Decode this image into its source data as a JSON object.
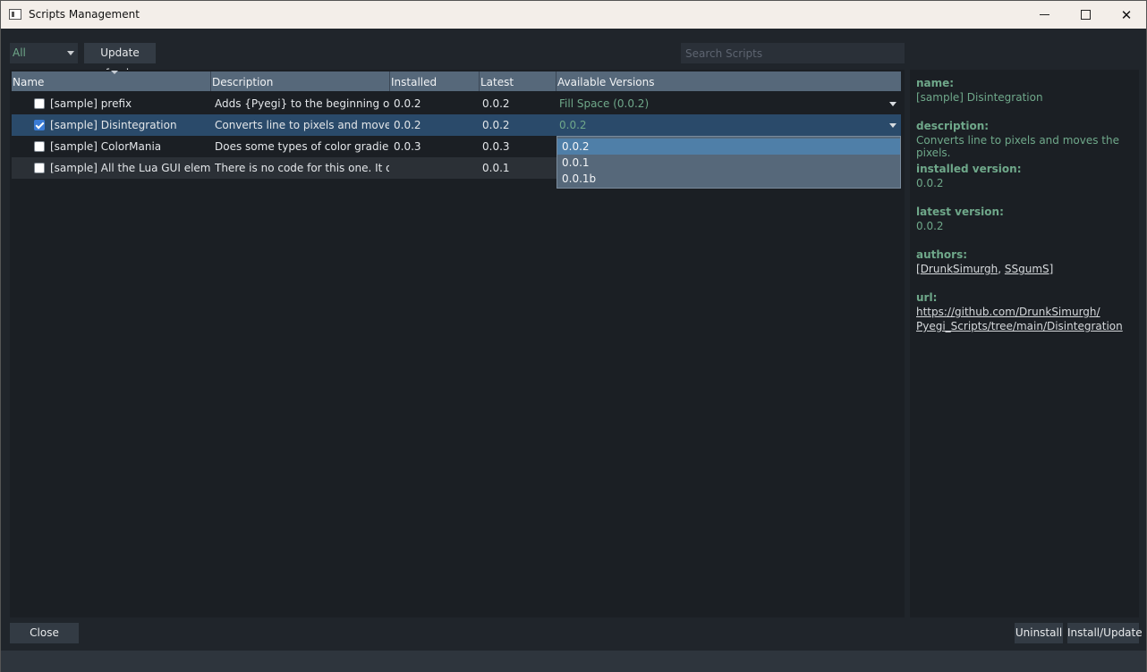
{
  "window": {
    "title": "Scripts Management"
  },
  "toolbar": {
    "filter_value": "All",
    "update_feeds_label": "Update feeds",
    "search_placeholder": "Search Scripts"
  },
  "table": {
    "columns": [
      "Name",
      "Description",
      "Installed Version",
      "Latest Version",
      "Available Versions"
    ],
    "rows": [
      {
        "checked": false,
        "name": "[sample] prefix",
        "description": "Adds {Pyegi} to the beginning of d...",
        "installed": "0.0.2",
        "latest": "0.0.2",
        "available": "Fill Space (0.0.2)"
      },
      {
        "checked": true,
        "name": "[sample] Disintegration",
        "description": "Converts line to pixels and moves t...",
        "installed": "0.0.2",
        "latest": "0.0.2",
        "available": "0.0.2"
      },
      {
        "checked": false,
        "name": "[sample] ColorMania",
        "description": "Does some types of color gradient...",
        "installed": "0.0.3",
        "latest": "0.0.3",
        "available": ""
      },
      {
        "checked": false,
        "name": "[sample] All the Lua GUI elements",
        "description": "There is no code for this one. It onl...",
        "installed": "",
        "latest": "0.0.1",
        "available": ""
      }
    ],
    "dropdown_options": [
      "0.0.2",
      "0.0.1",
      "0.0.1b"
    ]
  },
  "details": {
    "name_label": "name:",
    "name_value": "[sample] Disintegration",
    "description_label": "description:",
    "description_value": "Converts line to pixels and moves the pixels.",
    "installed_label": "installed version:",
    "installed_value": "0.0.2",
    "latest_label": "latest version:",
    "latest_value": "0.0.2",
    "authors_label": "authors:",
    "authors_open": "[",
    "author_1": "DrunkSimurgh",
    "authors_sep": ", ",
    "author_2": "SSgumS",
    "authors_close": "]",
    "url_label": "url:",
    "url_line1": "https://github.com/DrunkSimurgh/",
    "url_line2": "Pyegi_Scripts/tree/main/Disintegration"
  },
  "footer": {
    "close_label": "Close",
    "uninstall_label": "Uninstall",
    "install_label": "Install/Update"
  },
  "colors": {
    "accent_green": "#6fa88a",
    "header_bg": "#56687a",
    "selected_row": "#2a4a6a"
  }
}
